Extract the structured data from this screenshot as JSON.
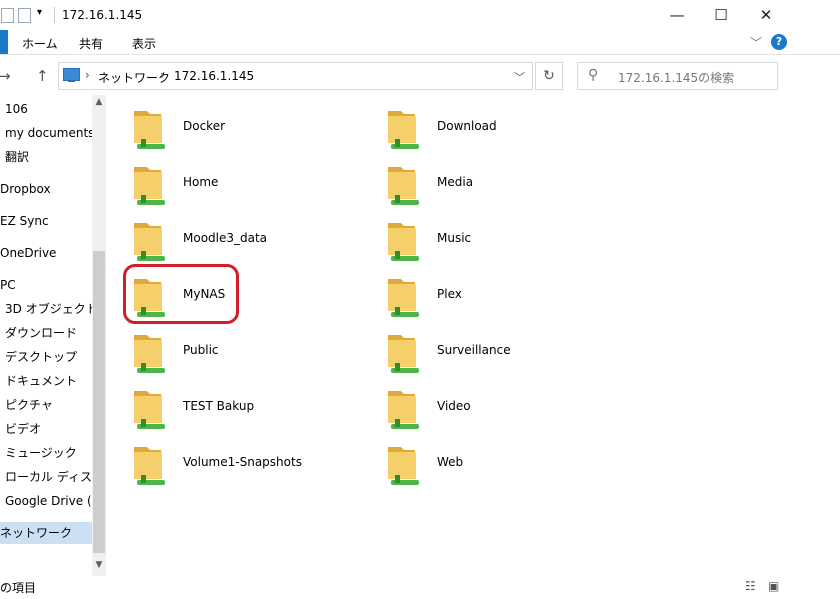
{
  "window": {
    "title": "172.16.1.145",
    "controls": {
      "minimize": "—",
      "maximize": "☐",
      "close": "✕"
    }
  },
  "ribbon": {
    "tabs": [
      "ホーム",
      "共有",
      "表示"
    ],
    "help": "?"
  },
  "nav": {
    "back": "←",
    "forward": "→",
    "up": "↑",
    "breadcrumb": [
      "ネットワーク",
      "172.16.1.145"
    ],
    "refresh": "↻",
    "search_placeholder": "172.16.1.145の検索"
  },
  "sidebar": {
    "items": [
      {
        "label": "106",
        "selected": false
      },
      {
        "label": "my documents",
        "selected": false
      },
      {
        "label": "翻訳",
        "selected": false
      },
      {
        "label": "Dropbox",
        "selected": false
      },
      {
        "label": "EZ Sync",
        "selected": false
      },
      {
        "label": "OneDrive",
        "selected": false
      },
      {
        "label": "PC",
        "selected": false
      },
      {
        "label": "3D オブジェクト",
        "selected": false
      },
      {
        "label": "ダウンロード",
        "selected": false
      },
      {
        "label": "デスクトップ",
        "selected": false
      },
      {
        "label": "ドキュメント",
        "selected": false
      },
      {
        "label": "ピクチャ",
        "selected": false
      },
      {
        "label": "ビデオ",
        "selected": false
      },
      {
        "label": "ミュージック",
        "selected": false
      },
      {
        "label": "ローカル ディスク (C",
        "selected": false
      },
      {
        "label": "Google Drive (G:",
        "selected": false
      },
      {
        "label": "ネットワーク",
        "selected": true
      }
    ]
  },
  "folders": [
    {
      "name": "Docker"
    },
    {
      "name": "Download"
    },
    {
      "name": "Home"
    },
    {
      "name": "Media"
    },
    {
      "name": "Moodle3_data"
    },
    {
      "name": "Music"
    },
    {
      "name": "MyNAS"
    },
    {
      "name": "Plex"
    },
    {
      "name": "Public"
    },
    {
      "name": "Surveillance"
    },
    {
      "name": "TEST Bakup"
    },
    {
      "name": "Video"
    },
    {
      "name": "Volume1-Snapshots"
    },
    {
      "name": "Web"
    }
  ],
  "highlighted_folder": "MyNAS",
  "status": {
    "text": "の項目"
  },
  "colors": {
    "accent": "#1979ca",
    "highlight": "#d01f2a",
    "folder": "#f1c75a",
    "share_pipe": "#4cb748",
    "selection": "#cce0f4"
  }
}
